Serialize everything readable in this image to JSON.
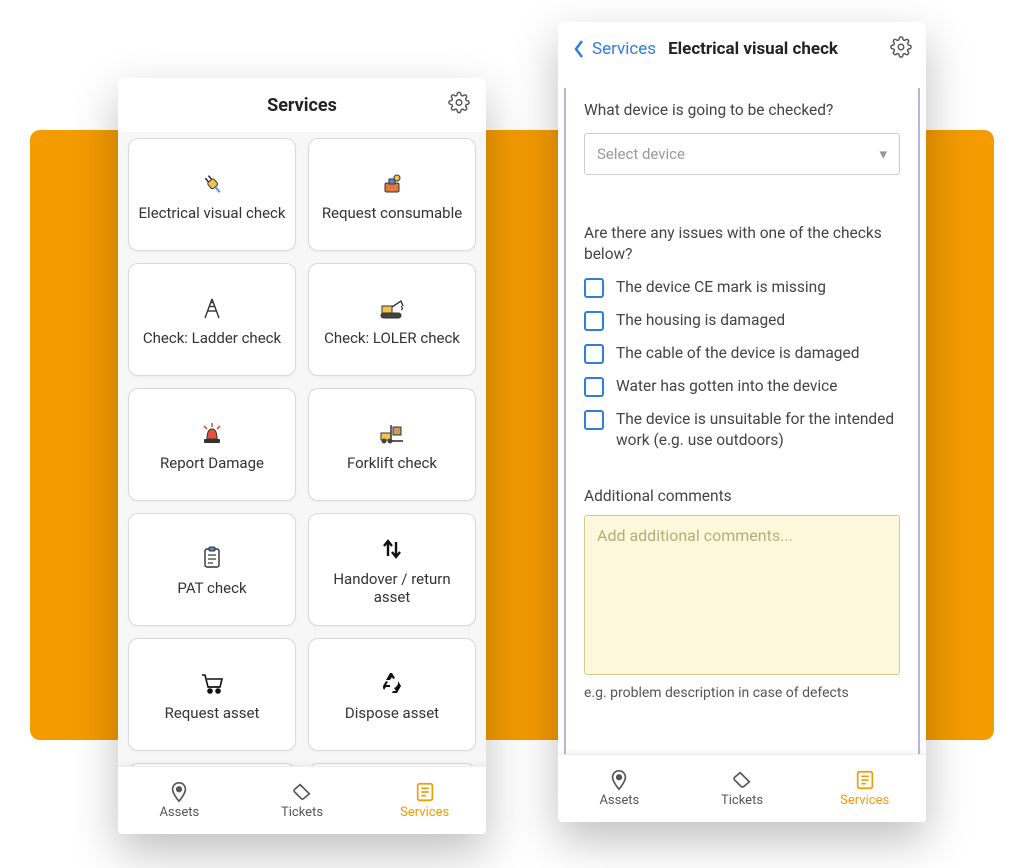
{
  "left": {
    "title": "Services",
    "cards": [
      {
        "label": "Electrical visual check"
      },
      {
        "label": "Request consumable"
      },
      {
        "label": "Check: Ladder check"
      },
      {
        "label": "Check: LOLER check"
      },
      {
        "label": "Report Damage"
      },
      {
        "label": "Forklift check"
      },
      {
        "label": "PAT check"
      },
      {
        "label": "Handover / return asset"
      },
      {
        "label": "Request asset"
      },
      {
        "label": "Dispose asset"
      }
    ]
  },
  "tabs": {
    "assets": "Assets",
    "tickets": "Tickets",
    "services": "Services"
  },
  "right": {
    "back_label": "Services",
    "title": "Electrical visual check",
    "q1": "What device is going to be checked?",
    "select_placeholder": "Select device",
    "q2": "Are there any issues with one of the checks below?",
    "checks": [
      "The device CE mark is missing",
      "The housing is damaged",
      "The cable of the device is damaged",
      "Water has gotten into the device",
      "The device is unsuitable for the intended work (e.g. use outdoors)"
    ],
    "comments_label": "Additional comments",
    "comments_placeholder": "Add additional comments...",
    "comments_hint": "e.g. problem description in case of defects"
  }
}
